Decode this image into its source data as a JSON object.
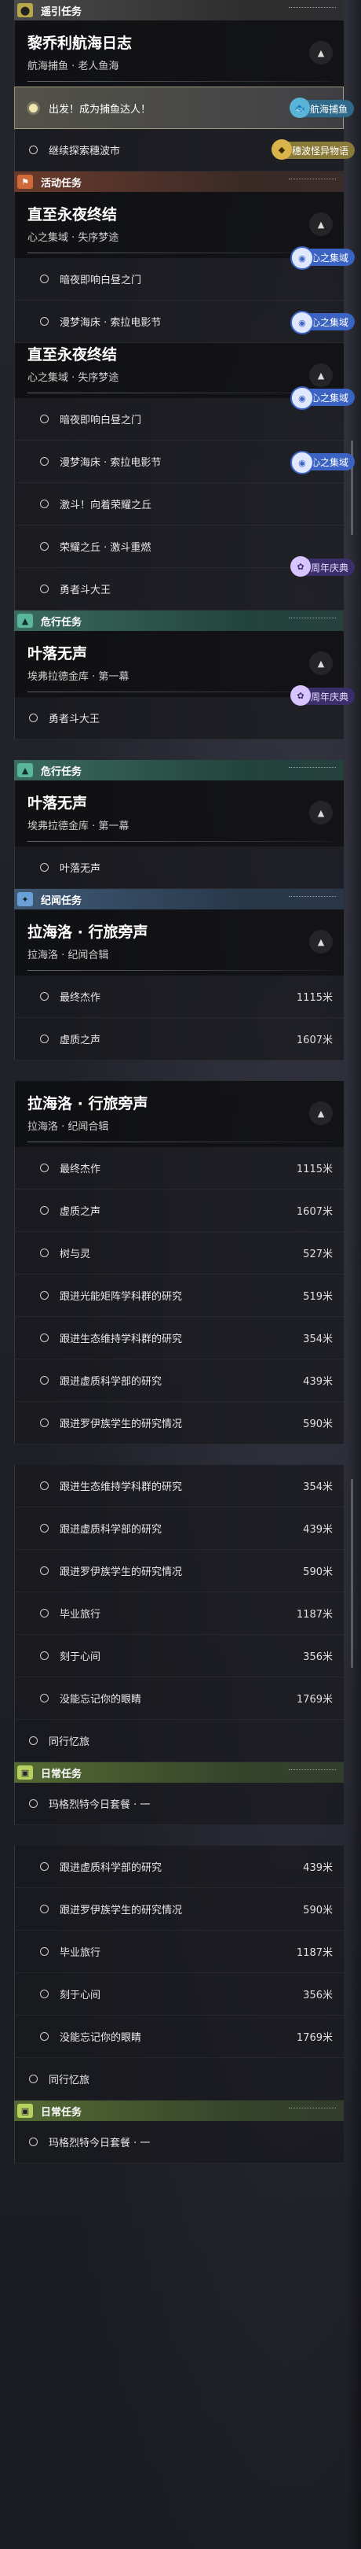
{
  "sections": {
    "guide": {
      "icon": "location-pin-icon",
      "title": "遥引任务"
    },
    "activity": {
      "icon": "flag-icon",
      "title": "活动任务"
    },
    "danger": {
      "icon": "warning-icon",
      "title": "危行任务"
    },
    "story": {
      "icon": "star-icon",
      "title": "纪闻任务"
    },
    "daily": {
      "icon": "book-icon",
      "title": "日常任务"
    }
  },
  "quests": {
    "fisher": {
      "name": "黎乔利航海日志",
      "sub": "航海捕鱼 · 老人鱼海"
    },
    "endless": {
      "name": "直至永夜终结",
      "sub": "心之集域 · 失序梦途"
    },
    "endless_cut": {
      "name": "直至永夜终结",
      "sub": "心之集域 · 失序梦途"
    },
    "leaf": {
      "name": "叶落无声",
      "sub": "埃弗拉德金库 · 第一幕"
    },
    "leaf2": {
      "name": "叶落无声",
      "sub": "埃弗拉德金库 · 第一幕"
    },
    "lahai": {
      "name": "拉海洛 · 行旅旁声",
      "sub": "拉海洛 · 纪闻合辑"
    },
    "lahai2": {
      "name": "拉海洛 · 行旅旁声",
      "sub": "拉海洛 · 纪闻合辑"
    }
  },
  "tags": {
    "fishing": "航海捕鱼",
    "ghost": "穗波怪异物语",
    "heart": "心之集域",
    "anniv": "周年庆典"
  },
  "steps": {
    "fisher": [
      {
        "label": "出发！成为捕鱼达人！",
        "active": true
      },
      {
        "label": "继续探索穗波市"
      }
    ],
    "endless": [
      {
        "label": "暗夜即响白昼之门"
      },
      {
        "label": "漫梦海床 · 索拉电影节"
      }
    ],
    "endless_cut": [
      {
        "label": "暗夜即响白昼之门"
      },
      {
        "label": "漫梦海床 · 索拉电影节"
      },
      {
        "label": "激斗！向着荣耀之丘"
      },
      {
        "label": "荣耀之丘 · 激斗重燃"
      },
      {
        "label": "勇者斗大王"
      }
    ],
    "leaf": [
      {
        "label": "勇者斗大王"
      }
    ],
    "leaf2": [
      {
        "label": "叶落无声"
      }
    ],
    "lahai": [
      {
        "label": "最终杰作",
        "dist": "1115米"
      },
      {
        "label": "虚质之声",
        "dist": "1607米"
      }
    ],
    "lahai2": [
      {
        "label": "最终杰作",
        "dist": "1115米"
      },
      {
        "label": "虚质之声",
        "dist": "1607米"
      },
      {
        "label": "树与灵",
        "dist": "527米"
      },
      {
        "label": "跟进光能矩阵学科群的研究",
        "dist": "519米"
      },
      {
        "label": "跟进生态维持学科群的研究",
        "dist": "354米"
      },
      {
        "label": "跟进虚质科学部的研究",
        "dist": "439米"
      },
      {
        "label": "跟进罗伊族学生的研究情况",
        "dist": "590米"
      }
    ],
    "lahai3": [
      {
        "label": "跟进生态维持学科群的研究",
        "dist": "354米"
      },
      {
        "label": "跟进虚质科学部的研究",
        "dist": "439米"
      },
      {
        "label": "跟进罗伊族学生的研究情况",
        "dist": "590米"
      },
      {
        "label": "毕业旅行",
        "dist": "1187米"
      },
      {
        "label": "刻于心间",
        "dist": "356米"
      },
      {
        "label": "没能忘记你的眼睛",
        "dist": "1769米"
      }
    ],
    "misc1": [
      {
        "label": "同行忆旅"
      }
    ],
    "daily1": [
      {
        "label": "玛格烈特今日套餐 · 一"
      }
    ],
    "lahai4": [
      {
        "label": "跟进虚质科学部的研究",
        "dist": "439米"
      },
      {
        "label": "跟进罗伊族学生的研究情况",
        "dist": "590米"
      },
      {
        "label": "毕业旅行",
        "dist": "1187米"
      },
      {
        "label": "刻于心间",
        "dist": "356米"
      },
      {
        "label": "没能忘记你的眼睛",
        "dist": "1769米"
      }
    ],
    "misc2": [
      {
        "label": "同行忆旅"
      }
    ],
    "daily2": [
      {
        "label": "玛格烈特今日套餐 · 一"
      }
    ]
  },
  "icons": {
    "collapse": "chevron-up-icon",
    "step": "circle-bullet-icon"
  }
}
